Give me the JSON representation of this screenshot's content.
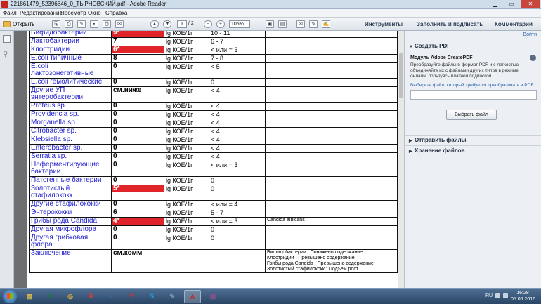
{
  "window": {
    "title": "221861479_52396846_0_ТЫРНОВСКИЙ.pdf - Adobe Reader",
    "min_icon": "minimize-icon",
    "max_icon": "maximize-icon",
    "close_icon": "close-icon"
  },
  "menu": [
    "Файл",
    "Редактирование",
    "Просмотр",
    "Окно",
    "Справка"
  ],
  "toolbar": {
    "open_label": "Открыть",
    "page_current": "1",
    "page_total": "/ 2",
    "zoom": "105%",
    "tabs": [
      "Инструменты",
      "Заполнить и подписать",
      "Комментарии"
    ]
  },
  "report": {
    "rows": [
      {
        "name": "Бифидобактерии",
        "value": "9*",
        "flag": true,
        "unit": "lg КОЕ/1г",
        "ref": "10 - 11",
        "comment": ""
      },
      {
        "name": "Лактобактерии",
        "value": "7",
        "flag": false,
        "unit": "lg КОЕ/1г",
        "ref": "6 - 7",
        "comment": ""
      },
      {
        "name": "Клостридии",
        "value": "6*",
        "flag": true,
        "unit": "lg КОЕ/1г",
        "ref": "< или = 3",
        "comment": ""
      },
      {
        "name": "E.coli типичные",
        "value": "8",
        "flag": false,
        "unit": "lg КОЕ/1г",
        "ref": "7 - 8",
        "comment": ""
      },
      {
        "name": "E.coli лактозонегативные",
        "value": "0",
        "flag": false,
        "unit": "lg КОЕ/1г",
        "ref": "< 5",
        "comment": "",
        "tall": true
      },
      {
        "name": "E.coli гемолитические",
        "value": "0",
        "flag": false,
        "unit": "lg КОЕ/1г",
        "ref": "0",
        "comment": ""
      },
      {
        "name": "Другие УП энтеробактерии",
        "value": "см.ниже",
        "flag": false,
        "unit": "lg КОЕ/1г",
        "ref": "< 4",
        "comment": "",
        "tall": true
      },
      {
        "name": "Proteus sp.",
        "value": "0",
        "flag": false,
        "unit": "lg КОЕ/1г",
        "ref": "< 4",
        "comment": ""
      },
      {
        "name": "Providencia sp.",
        "value": "0",
        "flag": false,
        "unit": "lg КОЕ/1г",
        "ref": "< 4",
        "comment": ""
      },
      {
        "name": "Morganella sp.",
        "value": "0",
        "flag": false,
        "unit": "lg КОЕ/1г",
        "ref": "< 4",
        "comment": ""
      },
      {
        "name": "Citrobacter sp.",
        "value": "0",
        "flag": false,
        "unit": "lg КОЕ/1г",
        "ref": "<  4",
        "comment": ""
      },
      {
        "name": "Klebsiella sp.",
        "value": "0",
        "flag": false,
        "unit": "lg КОЕ/1г",
        "ref": "< 4",
        "comment": ""
      },
      {
        "name": "Enterobacter sp.",
        "value": "0",
        "flag": false,
        "unit": "lg КОЕ/1г",
        "ref": "< 4",
        "comment": ""
      },
      {
        "name": "Serratia sp.",
        "value": "0",
        "flag": false,
        "unit": "lg КОЕ/1г",
        "ref": "< 4",
        "comment": ""
      },
      {
        "name": "Неферментирующие бактерии",
        "value": "0",
        "flag": false,
        "unit": "lg КОЕ/1г",
        "ref": "< или = 3",
        "comment": "",
        "tall": true
      },
      {
        "name": "Патогенные бактерии",
        "value": "0",
        "flag": false,
        "unit": "lg КОЕ/1г",
        "ref": "0",
        "comment": ""
      },
      {
        "name": "Золотистый стафилококк",
        "value": "5*",
        "flag": true,
        "unit": "lg КОЕ/1г",
        "ref": "0",
        "comment": "",
        "tall": true
      },
      {
        "name": "Другие стафилококки",
        "value": "0",
        "flag": false,
        "unit": "lg КОЕ/1г",
        "ref": "< или = 4",
        "comment": ""
      },
      {
        "name": "Энтерококки",
        "value": "6",
        "flag": false,
        "unit": "lg КОЕ/1г",
        "ref": "5 - 7",
        "comment": ""
      },
      {
        "name": "Грибы рода Candida",
        "value": "4*",
        "flag": true,
        "unit": "lg КОЕ/1г",
        "ref": "< или = 3",
        "comment": "Candida albicans"
      },
      {
        "name": "Другая микрофлора",
        "value": "0",
        "flag": false,
        "unit": "lg КОЕ/1г",
        "ref": "0",
        "comment": ""
      },
      {
        "name": "Другая грибковая флора",
        "value": "0",
        "flag": false,
        "unit": "lg КОЕ/1г",
        "ref": "0",
        "comment": "",
        "tall": true
      },
      {
        "name": "Заключение",
        "value": "см.комм",
        "flag": false,
        "unit": "",
        "ref": "",
        "comment": "Бифидобактерии : Понижено содержание\nКлостридии : Превышено содержание\nГрибы рода Candida : Превышено содержание\nЗолотистый стафилококк : Подъем рост",
        "conclusion": true
      }
    ]
  },
  "right_pane": {
    "login": "Войти",
    "create_pdf": "Создать PDF",
    "module_title": "Модуль Adobe CreatePDF",
    "module_desc": "Преобразуйте файлы в формат PDF и с легкостью объединяйте их с файлами других типов в режиме онлайн, пользуясь платной подпиской.",
    "choose_hint": "Выберите файл, который требуется преобразовать в PDF:",
    "choose_button": "Выбрать файл",
    "send_files": "Отправить файлы",
    "store_files": "Хранение файлов"
  },
  "taskbar": {
    "apps": [
      {
        "icon": "explorer-icon",
        "glyph": "▤",
        "color": "#e7c24b"
      },
      {
        "icon": "excel-icon",
        "glyph": "X",
        "color": "#1d7a3a"
      },
      {
        "icon": "chrome-icon",
        "glyph": "◎",
        "color": "#e5b13a"
      },
      {
        "icon": "yandex-icon",
        "glyph": "Я",
        "color": "#e23a2e"
      },
      {
        "icon": "media-player-icon",
        "glyph": "◐",
        "color": "#3a73c4"
      },
      {
        "icon": "yandex-browser-icon",
        "glyph": "Y",
        "color": "#d9302a"
      },
      {
        "icon": "skype-icon",
        "glyph": "S",
        "color": "#1aa1e1"
      },
      {
        "icon": "notepad-icon",
        "glyph": "✎",
        "color": "#7a95b8"
      },
      {
        "icon": "acrobat-icon",
        "glyph": "A",
        "color": "#c9241c"
      },
      {
        "icon": "winrar-icon",
        "glyph": "▦",
        "color": "#8a4f8d"
      }
    ],
    "lang": "RU",
    "time": "16:28",
    "date": "05.05.2016"
  }
}
